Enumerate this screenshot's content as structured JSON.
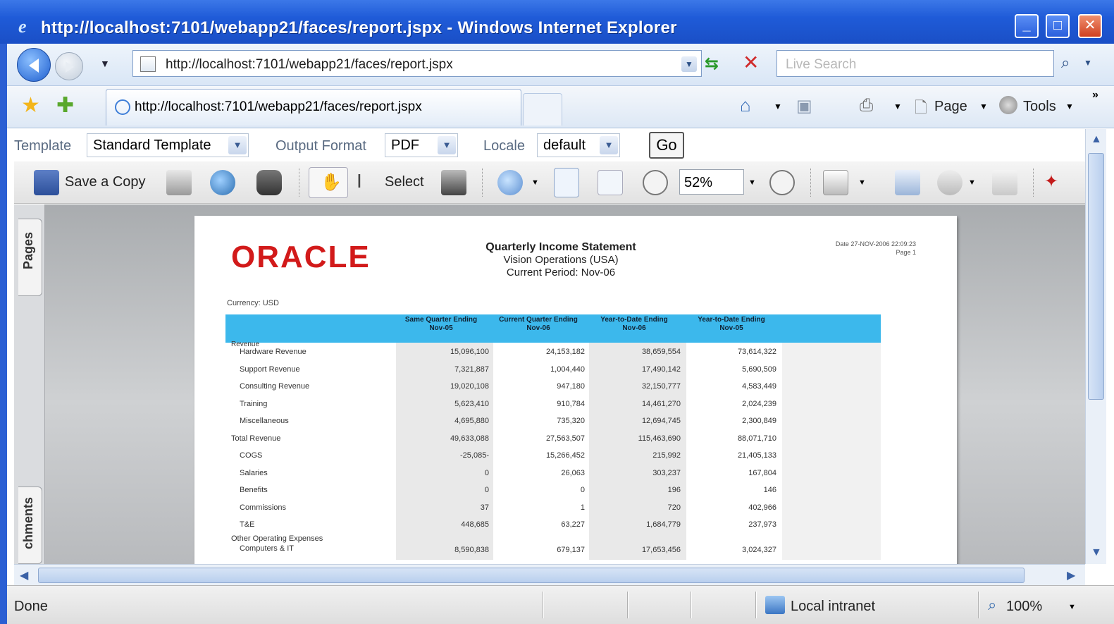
{
  "window": {
    "title": "http://localhost:7101/webapp21/faces/report.jspx - Windows Internet Explorer"
  },
  "nav": {
    "address": "http://localhost:7101/webapp21/faces/report.jspx",
    "search_placeholder": "Live Search"
  },
  "commandbar": {
    "tab_title": "http://localhost:7101/webapp21/faces/report.jspx",
    "page_label": "Page",
    "tools_label": "Tools"
  },
  "params": {
    "template_label": "Template",
    "template_value": "Standard Template",
    "output_label": "Output Format",
    "output_value": "PDF",
    "locale_label": "Locale",
    "locale_value": "default",
    "go_label": "Go"
  },
  "pdf_toolbar": {
    "save_copy": "Save a Copy",
    "select": "Select",
    "zoom": "52%"
  },
  "side_tabs": {
    "pages": "Pages",
    "attachments": "chments"
  },
  "report": {
    "logo": "ORACLE",
    "title": "Quarterly Income Statement",
    "subtitle": "Vision Operations (USA)",
    "period": "Current Period: Nov-06",
    "date": "Date 27-NOV-2006 22:09:23",
    "page": "Page 1",
    "currency": "Currency: USD",
    "headers": [
      "Same Quarter Ending Nov-05",
      "Current Quarter Ending Nov-06",
      "Year-to-Date Ending Nov-06",
      "Year-to-Date Ending Nov-05"
    ],
    "revenue_heading": "Revenue",
    "other_heading": "Other Operating Expenses",
    "rows": [
      {
        "label": "Hardware Revenue",
        "v": [
          "15,096,100",
          "24,153,182",
          "38,659,554",
          "73,614,322"
        ]
      },
      {
        "label": "Support Revenue",
        "v": [
          "7,321,887",
          "1,004,440",
          "17,490,142",
          "5,690,509"
        ]
      },
      {
        "label": "Consulting Revenue",
        "v": [
          "19,020,108",
          "947,180",
          "32,150,777",
          "4,583,449"
        ]
      },
      {
        "label": "Training",
        "v": [
          "5,623,410",
          "910,784",
          "14,461,270",
          "2,024,239"
        ]
      },
      {
        "label": "Miscellaneous",
        "v": [
          "4,695,880",
          "735,320",
          "12,694,745",
          "2,300,849"
        ]
      },
      {
        "label": "Total Revenue",
        "v": [
          "49,633,088",
          "27,563,507",
          "115,463,690",
          "88,071,710"
        ]
      },
      {
        "label": "COGS",
        "v": [
          "-25,085-",
          "15,266,452",
          "215,992",
          "21,405,133"
        ]
      },
      {
        "label": "Salaries",
        "v": [
          "0",
          "26,063",
          "303,237",
          "167,804"
        ]
      },
      {
        "label": "Benefits",
        "v": [
          "0",
          "0",
          "196",
          "146"
        ]
      },
      {
        "label": "Commissions",
        "v": [
          "37",
          "1",
          "720",
          "402,966"
        ]
      },
      {
        "label": "T&E",
        "v": [
          "448,685",
          "63,227",
          "1,684,779",
          "237,973"
        ]
      },
      {
        "label": "Computers & IT",
        "v": [
          "8,590,838",
          "679,137",
          "17,653,456",
          "3,024,327"
        ]
      }
    ]
  },
  "status": {
    "text": "Done",
    "zone": "Local intranet",
    "zoom": "100%"
  }
}
